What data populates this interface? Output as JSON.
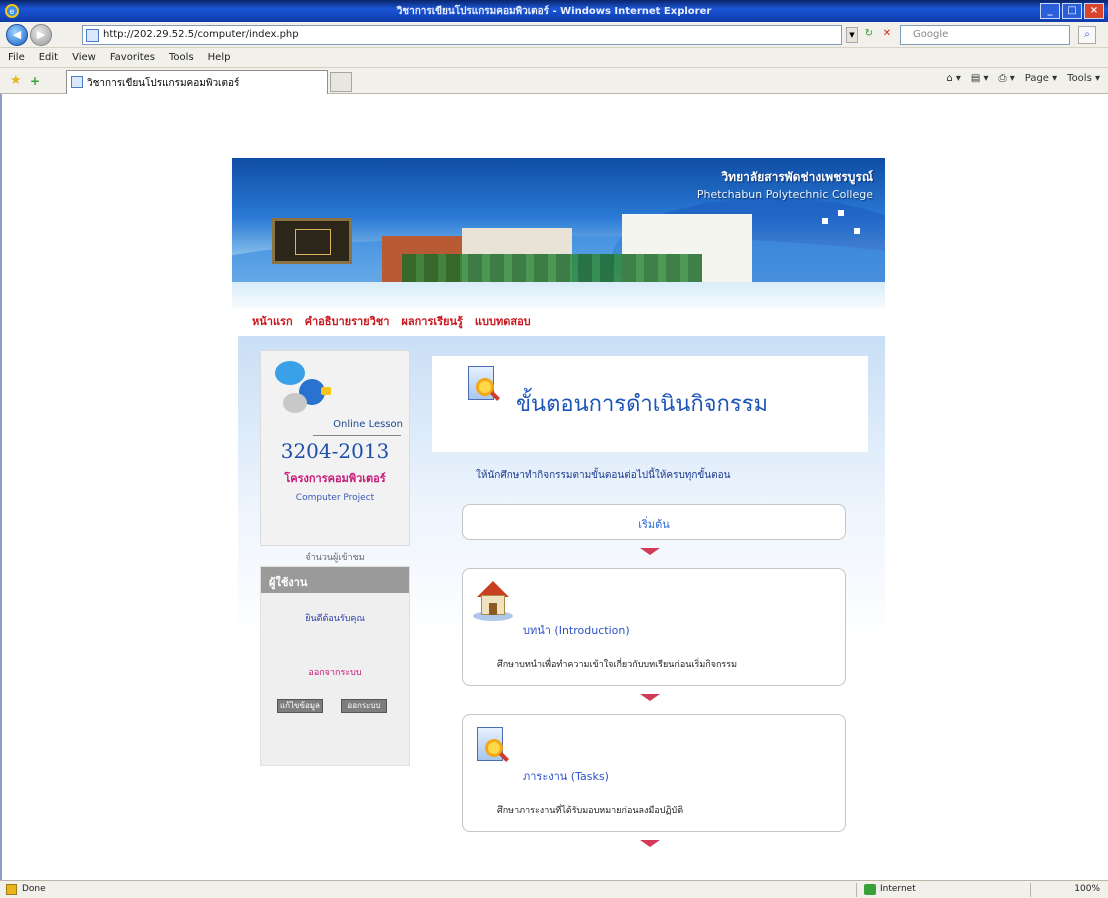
{
  "window": {
    "title": "วิชาการเขียนโปรแกรมคอมพิวเตอร์ - Windows Internet Explorer"
  },
  "browser": {
    "address": "http://202.29.52.5/computer/index.php",
    "search_placeholder": "Google",
    "menu": [
      "File",
      "Edit",
      "View",
      "Favorites",
      "Tools",
      "Help"
    ],
    "tab_title": "วิชาการเขียนโปรแกรมคอมพิวเตอร์",
    "command_tools": [
      "Page ▾",
      "Tools ▾"
    ]
  },
  "site": {
    "college_th": "วิทยาลัยสารพัดช่างเพชรบูรณ์",
    "college_en": "Phetchabun Polytechnic College",
    "nav": [
      "หน้าแรก",
      "คำอธิบายรายวิชา",
      "ผลการเรียนรู้",
      "แบบทดสอบ"
    ]
  },
  "sidebar": {
    "subject_label": "Online Lesson",
    "subject_code": "3204-2013",
    "subject_name": "โครงการคอมพิวเตอร์",
    "subject_en": "Computer Project",
    "caption": "จำนวนผู้เข้าชม",
    "login": {
      "heading": "ผู้ใช้งาน",
      "user": "ยินดีต้อนรับคุณ",
      "status": "ออกจากระบบ",
      "buttons": [
        "แก้ไขข้อมูล",
        "ออกระบบ"
      ]
    }
  },
  "content": {
    "title": "ขั้นตอนการดำเนินกิจกรรม",
    "intro": "ให้นักศึกษาทำกิจกรรมตามขั้นตอนต่อไปนี้ให้ครบทุกขั้นตอน",
    "start_label": "เริ่มต้น",
    "steps": [
      {
        "title": "บทนำ (Introduction)",
        "desc": "ศึกษาบทนำเพื่อทำความเข้าใจเกี่ยวกับบทเรียนก่อนเริ่มกิจกรรม"
      },
      {
        "title": "ภาระงาน (Tasks)",
        "desc": "ศึกษาภาระงานที่ได้รับมอบหมายก่อนลงมือปฏิบัติ"
      }
    ]
  },
  "statusbar": {
    "status": "Done",
    "zone": "Internet",
    "zoom": "100%"
  }
}
